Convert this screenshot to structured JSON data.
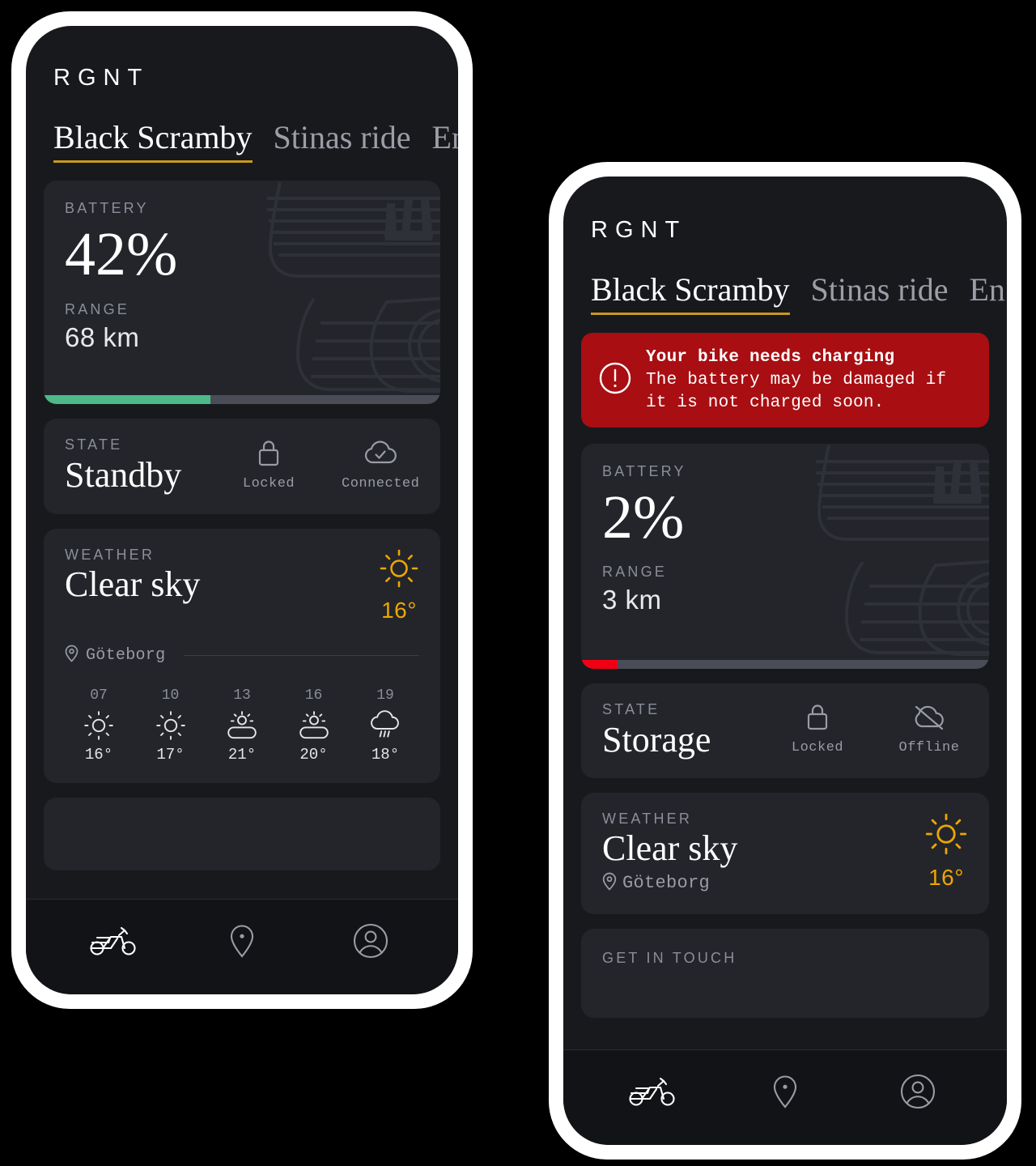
{
  "brand": "RGNT",
  "tabs": [
    {
      "label": "Black Scramby",
      "active": true
    },
    {
      "label": "Stinas ride",
      "active": false
    },
    {
      "label": "En",
      "active": false
    }
  ],
  "labels": {
    "battery": "BATTERY",
    "range": "RANGE",
    "state": "STATE",
    "weather": "WEATHER",
    "get_in_touch": "GET IN TOUCH"
  },
  "colors": {
    "accent_amber": "#C9991F",
    "weather_amber": "#EDA600",
    "battery_ok": "#4DB888",
    "battery_low": "#F00014",
    "alert_red": "#A80E12",
    "card_bg": "#23252B",
    "screen_bg": "#18191D"
  },
  "phone_one": {
    "battery": {
      "percent_text": "42%",
      "percent_value": 42,
      "range_text": "68 km",
      "bar_color": "#4DB888",
      "bar_fill_percent": 42
    },
    "state": {
      "value": "Standby",
      "indicators": [
        {
          "icon": "lock-icon",
          "label": "Locked"
        },
        {
          "icon": "cloud-check-icon",
          "label": "Connected"
        }
      ]
    },
    "weather": {
      "condition": "Clear sky",
      "icon": "sun-icon",
      "temperature": "16°",
      "location": "Göteborg",
      "hourly": [
        {
          "hour": "07",
          "icon": "sun-icon",
          "temp": "16°"
        },
        {
          "hour": "10",
          "icon": "sun-icon",
          "temp": "17°"
        },
        {
          "hour": "13",
          "icon": "sun-cloud-icon",
          "temp": "21°"
        },
        {
          "hour": "16",
          "icon": "sun-cloud-icon",
          "temp": "20°"
        },
        {
          "hour": "19",
          "icon": "rain-cloud-icon",
          "temp": "18°"
        }
      ]
    }
  },
  "phone_two": {
    "alert": {
      "icon": "exclamation-circle-icon",
      "title": "Your bike needs charging",
      "body": "The battery may be damaged if it is not charged soon."
    },
    "battery": {
      "percent_text": "2%",
      "percent_value": 2,
      "range_text": "3 km",
      "bar_color": "#F00014",
      "bar_fill_percent": 9
    },
    "state": {
      "value": "Storage",
      "indicators": [
        {
          "icon": "lock-icon",
          "label": "Locked"
        },
        {
          "icon": "cloud-off-icon",
          "label": "Offline"
        }
      ]
    },
    "weather": {
      "condition": "Clear sky",
      "icon": "sun-icon",
      "temperature": "16°",
      "location": "Göteborg"
    }
  },
  "bottom_nav": [
    {
      "icon": "motorcycle-icon",
      "active": true
    },
    {
      "icon": "location-pin-icon",
      "active": false
    },
    {
      "icon": "account-circle-icon",
      "active": false
    }
  ]
}
